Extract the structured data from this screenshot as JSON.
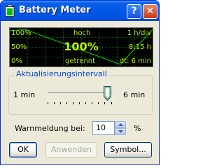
{
  "window": {
    "title": "Battery Meter",
    "help_glyph": "?",
    "close_glyph": "✕",
    "icon": "battery-icon"
  },
  "graph": {
    "labels": {
      "top_left": "100%",
      "top_center": "hoch",
      "top_right": "1 h/div",
      "mid_left": "50%",
      "mid_right": "8:15 h",
      "bottom_left": "0%",
      "bottom_center": "getrennt",
      "bottom_right": "dt: 6 min"
    },
    "current_level": "100%",
    "colors": {
      "background": "#000000",
      "grid": "#006000",
      "line": "#00d000",
      "text": "#b8f000"
    }
  },
  "update_interval": {
    "legend": "Aktualisierungsintervall",
    "min_label": "1 min",
    "max_label": "6 min",
    "value_fraction": 1.0
  },
  "warning": {
    "label": "Warnmeldung bei:",
    "value": "10",
    "unit": "%"
  },
  "buttons": {
    "ok": "OK",
    "apply": "Anwenden",
    "symbol": "Symbol..."
  }
}
